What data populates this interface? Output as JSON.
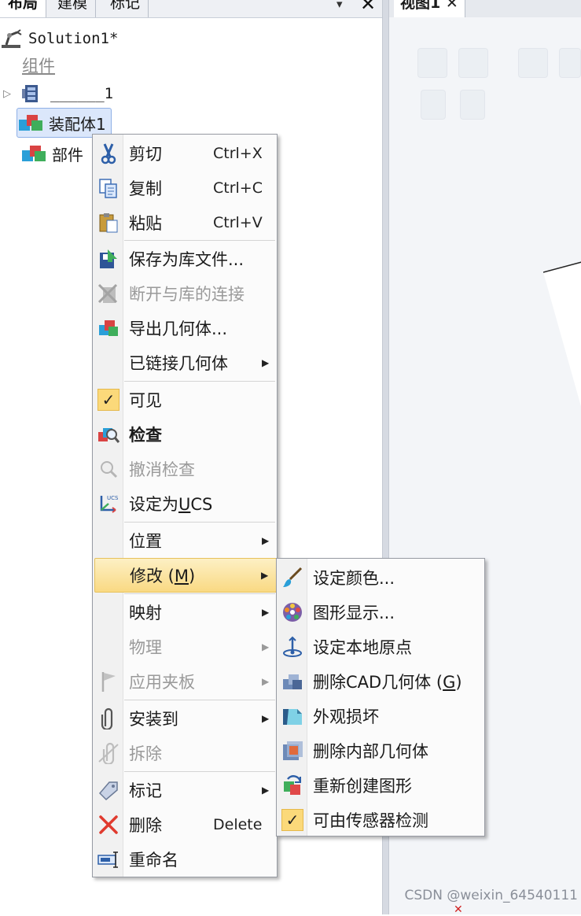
{
  "left_panel": {
    "tabs": [
      "布局",
      "建模",
      "标记"
    ],
    "pin_glyph": "▾",
    "close_glyph": "✕",
    "tree": {
      "solution": "Solution1*",
      "components_label": "组件",
      "item1": "______1",
      "item2": "装配体1",
      "item3": "部件"
    }
  },
  "view": {
    "tab_label": "视图1",
    "tab_close": "✕",
    "watermark": "CSDN @weixin_64540111",
    "corner_mark": "✕"
  },
  "context_menu": {
    "cut": {
      "label": "剪切",
      "shortcut": "Ctrl+X"
    },
    "copy": {
      "label": "复制",
      "shortcut": "Ctrl+C"
    },
    "paste": {
      "label": "粘贴",
      "shortcut": "Ctrl+V"
    },
    "save_library": {
      "label": "保存为库文件..."
    },
    "disconnect_library": {
      "label": "断开与库的连接"
    },
    "export_geometry": {
      "label": "导出几何体..."
    },
    "linked_geometry": {
      "label": "已链接几何体"
    },
    "visible": {
      "label": "可见",
      "checked": true
    },
    "inspect": {
      "label": "检查"
    },
    "cancel_inspect": {
      "label": "撤消检查"
    },
    "set_ucs": {
      "label_prefix": "设定为",
      "label_mnemonic": "U",
      "label_suffix": "CS"
    },
    "position": {
      "label": "位置"
    },
    "modify": {
      "label": "修改",
      "mnemonic_open": " (",
      "mnemonic": "M",
      "mnemonic_close": ")"
    },
    "mapping": {
      "label": "映射"
    },
    "physics": {
      "label": "物理"
    },
    "apply_fixture": {
      "label": "应用夹板"
    },
    "mount_to": {
      "label": "安装到"
    },
    "detach": {
      "label": "拆除"
    },
    "markup": {
      "label": "标记"
    },
    "delete": {
      "label": "删除",
      "shortcut": "Delete"
    },
    "rename": {
      "label": "重命名"
    }
  },
  "submenu_modify": {
    "set_color": "设定颜色...",
    "graphic_display": "图形显示...",
    "set_local_origin": "设定本地原点",
    "delete_cad": {
      "label": "删除CAD几何体",
      "mnemonic_open": " (",
      "mnemonic": "G",
      "mnemonic_close": ")"
    },
    "appearance_damage": "外观损坏",
    "delete_internal": "删除内部几何体",
    "recreate_graphics": "重新创建图形",
    "sensor_detectable": {
      "label": "可由传感器检测",
      "checked": true
    }
  },
  "colors": {
    "highlight": "#f9d983",
    "selection": "#dbe7fb",
    "disabled_text": "#9a9a9a"
  }
}
